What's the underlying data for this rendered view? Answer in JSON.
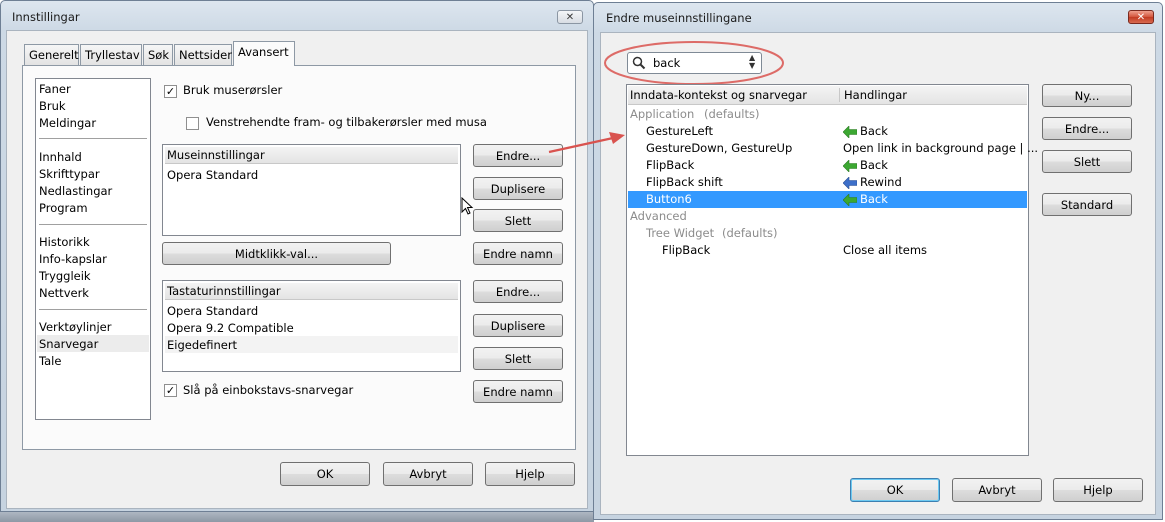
{
  "left_window": {
    "title": "Innstillingar",
    "close_label": "✕",
    "tabs": [
      "Generelt",
      "Tryllestav",
      "Søk",
      "Nettsider",
      "Avansert"
    ],
    "sidebar": [
      "Faner",
      "Bruk",
      "Meldingar",
      "Innhald",
      "Skrifttypar",
      "Nedlastingar",
      "Program",
      "Historikk",
      "Info-kapslar",
      "Tryggleik",
      "Nettverk",
      "Verktøylinjer",
      "Snarvegar",
      "Tale"
    ],
    "mouse_gestures_checkbox": "Bruk muserørsler",
    "left_handed_checkbox": "Venstrehendte fram- og tilbakerørsler med musa",
    "mouse_list_header": "Museinnstillingar",
    "mouse_list_items": [
      "Opera Standard"
    ],
    "mouse_buttons": {
      "edit": "Endre...",
      "duplicate": "Duplisere",
      "delete": "Slett",
      "rename": "Endre namn"
    },
    "middle_click_button": "Midtklikk-val...",
    "keyboard_list_header": "Tastaturinnstillingar",
    "keyboard_list_items": [
      "Opera Standard",
      "Opera 9.2 Compatible",
      "Eigedefinert"
    ],
    "keyboard_buttons": {
      "edit": "Endre...",
      "duplicate": "Duplisere",
      "delete": "Slett",
      "rename": "Endre namn"
    },
    "single_key_checkbox": "Slå på einbokstavs-snarvegar",
    "footer": {
      "ok": "OK",
      "cancel": "Avbryt",
      "help": "Hjelp"
    }
  },
  "right_window": {
    "title": "Endre museinnstillingane",
    "close_label": "✕",
    "search_value": "back",
    "columns": [
      "Inndata-kontekst og snarvegar",
      "Handlingar"
    ],
    "rows": [
      {
        "context": "Application",
        "extra": "(defaults)",
        "action": ""
      },
      {
        "context": "GestureLeft",
        "action": "Back",
        "icon": "back-arrow-icon"
      },
      {
        "context": "GestureDown, GestureUp",
        "action": "Open link in background page | ..."
      },
      {
        "context": "FlipBack",
        "action": "Back",
        "icon": "back-arrow-icon"
      },
      {
        "context": "FlipBack shift",
        "action": "Rewind",
        "icon": "rewind-arrow-icon"
      },
      {
        "context": "Button6",
        "action": "Back",
        "icon": "back-arrow-icon"
      },
      {
        "context": "Advanced",
        "action": ""
      },
      {
        "context": "Tree Widget",
        "extra": "(defaults)",
        "action": ""
      },
      {
        "context": "FlipBack",
        "action": "Close all items"
      }
    ],
    "side_buttons": {
      "new": "Ny...",
      "edit": "Endre...",
      "delete": "Slett",
      "standard": "Standard"
    },
    "footer": {
      "ok": "OK",
      "cancel": "Avbryt",
      "help": "Hjelp"
    }
  },
  "colors": {
    "selection": "#3399ff",
    "annotation": "#d9534f",
    "arrow_green": "#3ca832",
    "arrow_blue": "#3d6fc9"
  }
}
